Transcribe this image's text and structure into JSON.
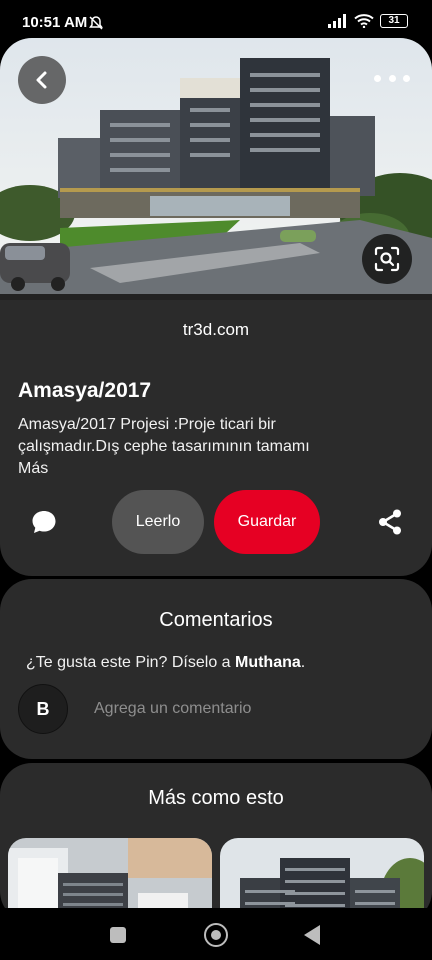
{
  "status_bar": {
    "time": "10:51 AM",
    "battery": "31"
  },
  "pin": {
    "source": "tr3d.com",
    "title": "Amasya/2017",
    "description": "Amasya/2017 Projesi :Proje ticari bir çalışmadır.Dış cephe tasarımının tamamı",
    "more_link": "Más",
    "read_button": "Leerlo",
    "save_button": "Guardar",
    "icons": {
      "back": "chevron-left-icon",
      "more": "more-options-icon",
      "lens": "visual-search-icon",
      "comment": "comment-bubble-icon",
      "share": "share-icon"
    }
  },
  "comments": {
    "title": "Comentarios",
    "prompt_text": "¿Te gusta este Pin? Díselo a ",
    "prompt_user": "Muthana",
    "prompt_end": ".",
    "avatar_initial": "B",
    "input_placeholder": "Agrega un comentario"
  },
  "more_like_this": {
    "title": "Más como esto"
  },
  "colors": {
    "accent": "#e60023",
    "card_background": "#2b2b2b",
    "secondary_button": "#545454"
  }
}
